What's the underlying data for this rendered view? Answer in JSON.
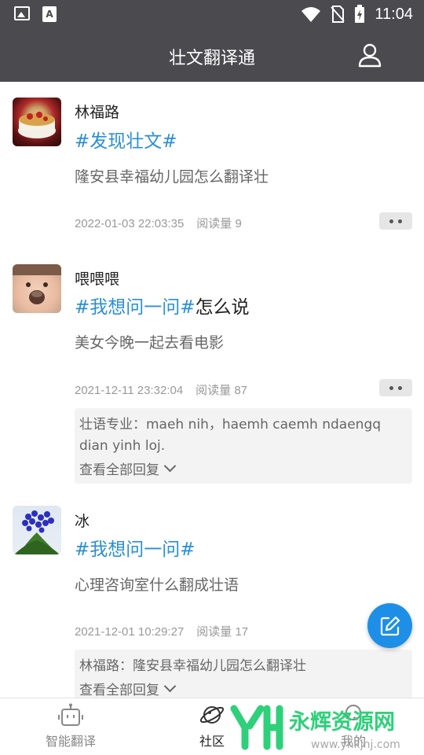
{
  "status_bar": {
    "time": "11:04",
    "app_badge": "A"
  },
  "header": {
    "title": "壮文翻译通",
    "profile_icon": "person-icon"
  },
  "posts": [
    {
      "author": "林福路",
      "tag": "#发现壮文#",
      "headline_suffix": "",
      "content": "隆安县幸福幼儿园怎么翻译壮",
      "timestamp": "2022-01-03 22:03:35",
      "reads": "阅读量 9"
    },
    {
      "author": "喂喂喂",
      "tag": "#我想问一问#",
      "headline_suffix": "怎么说",
      "content": "美女今晚一起去看电影",
      "timestamp": "2021-12-11 23:32:04",
      "reads": "阅读量 87",
      "reply": {
        "text": "壮语专业：maeh nih，haemh caemh ndaengq dian yinh loj.",
        "view_all": "查看全部回复"
      }
    },
    {
      "author": "冰",
      "tag": "#我想问一问#",
      "headline_suffix": "",
      "content": "心理咨询室什么翻成壮语",
      "timestamp": "2021-12-01 10:29:27",
      "reads": "阅读量 17",
      "reply": {
        "text": "林福路：隆安县幸福幼儿园怎么翻译壮",
        "view_all": "查看全部回复"
      }
    }
  ],
  "bottom_nav": [
    {
      "label": "智能翻译",
      "icon": "robot-icon",
      "active": false
    },
    {
      "label": "社区",
      "icon": "planet-icon",
      "active": true
    },
    {
      "label": "我的",
      "icon": "user-icon",
      "active": false
    }
  ],
  "watermark": {
    "text": "永辉资源网",
    "url_text": "www.yhkjhj.com"
  },
  "colors": {
    "header_bg": "#4a4a4f",
    "accent": "#2a8fd6",
    "fab": "#1e8fe6"
  }
}
